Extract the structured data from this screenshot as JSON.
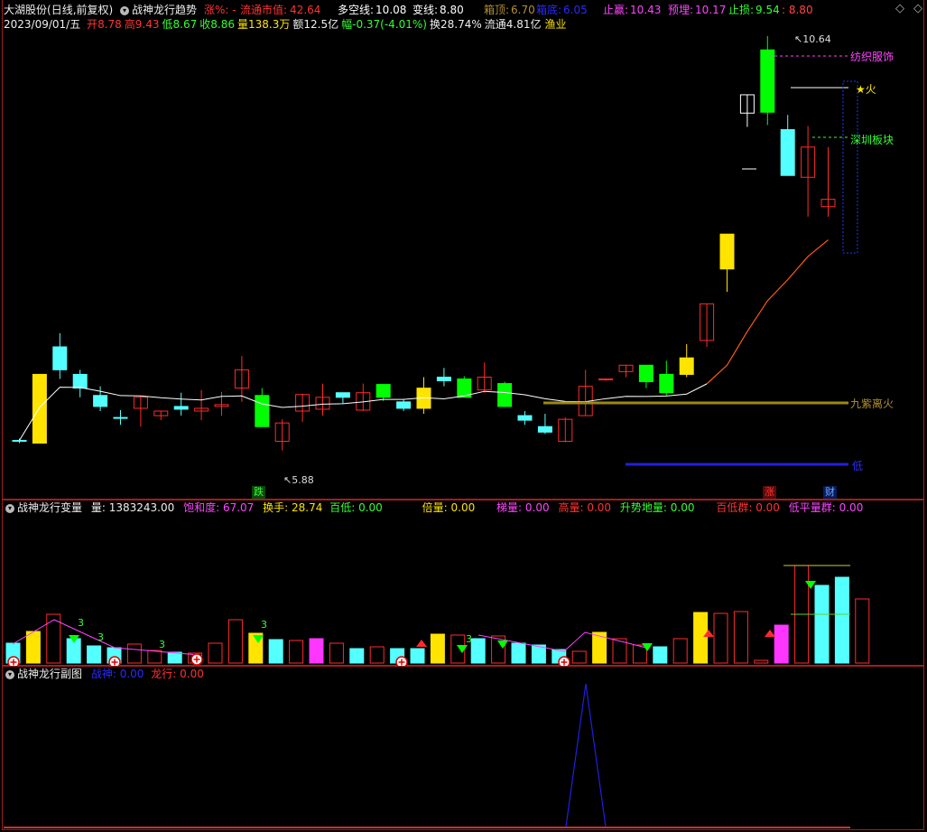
{
  "header1": {
    "stock_name": "大湖股份",
    "period": "(日线,前复权)",
    "indicator_name": "战神龙行趋势",
    "zhang_pct": "涨%: -",
    "liutong_label": "流通市值:",
    "liutong_value": "42.64",
    "duokong_label": "多空线:",
    "duokong_value": "10.08",
    "bianxian_label": "变线:",
    "bianxian_value": "8.80",
    "xiangding_label": "箱顶:",
    "xiangding_value": "6.70",
    "xiangdi_label": "箱底:",
    "xiangdi_value": "6.05",
    "zhiying_label": "止赢:",
    "zhiying_value": "10.43",
    "yuli_label": "预埋:",
    "yuli_value": "10.17",
    "zhisun_label": "止损:",
    "zhisun_value": "9.54",
    "last_value": ": 8.80"
  },
  "header2": {
    "date": "2023/09/01/五",
    "open_label": "开",
    "open": "8.78",
    "high_label": "高",
    "high": "9.43",
    "low_label": "低",
    "low": "8.67",
    "close_label": "收",
    "close": "8.86",
    "vol_label": "量",
    "vol": "138.3万",
    "amount_label": "额",
    "amount": "12.5亿",
    "change_label": "幅",
    "change": "-0.37(-4.01%)",
    "turnover_label": "换",
    "turnover": "28.74%",
    "float_label": "流通",
    "float": "4.81亿",
    "industry": "渔业"
  },
  "main_chart": {
    "high_label": "10.64",
    "low_label": "5.88",
    "tag_textile": "纺织服饰",
    "tag_fire": "★火",
    "tag_shenzhen": "深圳板块",
    "tag_jiuzi": "九紫离火",
    "tag_di": "低",
    "bottom_die": "跌",
    "bottom_zhang": "涨",
    "bottom_cai": "财"
  },
  "panel2": {
    "title": "战神龙行变量",
    "liang_label": "量:",
    "liang_value": "1383243.00",
    "baohe_label": "饱和度:",
    "baohe_value": "67.07",
    "huanshou_label": "换手:",
    "huanshou_value": "28.74",
    "baidi_label": "百低:",
    "baidi_value": "0.00",
    "beiliang_label": "倍量:",
    "beiliang_value": "0.00",
    "tiliang_label": "梯量:",
    "tiliang_value": "0.00",
    "gaoliang_label": "高量:",
    "gaoliang_value": "0.00",
    "shengshi_label": "升势地量:",
    "shengshi_value": "0.00",
    "baidiqun_label": "百低群:",
    "baidiqun_value": "0.00",
    "dipingliang_label": "低平量群:",
    "dipingliang_value": "0.00",
    "mark3": "3"
  },
  "panel3": {
    "title": "战神龙行副图",
    "zhanshen_label": "战神:",
    "zhanshen_value": "0.00",
    "longxing_label": "龙行:",
    "longxing_value": "0.00"
  },
  "colors": {
    "up": "#ff2b2b",
    "down_cyan": "#54ffff",
    "green": "#00ff00",
    "yellow": "#ffe400",
    "magenta": "#ff36ff",
    "blue": "#1a1aff"
  },
  "chart_data": {
    "type": "candlestick",
    "y_range_visible": [
      5.88,
      10.64
    ],
    "candles": [
      {
        "o": 6.22,
        "h": 6.25,
        "l": 6.2,
        "c": 6.23,
        "color": "cyan"
      },
      {
        "o": 6.2,
        "h": 6.95,
        "l": 6.2,
        "c": 6.95,
        "color": "yellow"
      },
      {
        "o": 7.0,
        "h": 7.4,
        "l": 6.9,
        "c": 7.25,
        "color": "cyan"
      },
      {
        "o": 6.95,
        "h": 7.0,
        "l": 6.7,
        "c": 6.8,
        "color": "cyan"
      },
      {
        "o": 6.72,
        "h": 6.82,
        "l": 6.55,
        "c": 6.6,
        "color": "cyan"
      },
      {
        "o": 6.48,
        "h": 6.56,
        "l": 6.4,
        "c": 6.48,
        "color": "cyan"
      },
      {
        "o": 6.58,
        "h": 6.72,
        "l": 6.38,
        "c": 6.7,
        "color": "red"
      },
      {
        "o": 6.5,
        "h": 6.55,
        "l": 6.45,
        "c": 6.55,
        "color": "red"
      },
      {
        "o": 6.6,
        "h": 6.75,
        "l": 6.5,
        "c": 6.57,
        "color": "cyan"
      },
      {
        "o": 6.55,
        "h": 6.78,
        "l": 6.45,
        "c": 6.58,
        "color": "red"
      },
      {
        "o": 6.6,
        "h": 6.76,
        "l": 6.5,
        "c": 6.62,
        "color": "red"
      },
      {
        "o": 6.8,
        "h": 7.15,
        "l": 6.65,
        "c": 7.0,
        "color": "red"
      },
      {
        "o": 6.72,
        "h": 6.8,
        "l": 6.38,
        "c": 6.38,
        "color": "green"
      },
      {
        "o": 6.22,
        "h": 6.46,
        "l": 6.12,
        "c": 6.42,
        "color": "red"
      },
      {
        "o": 6.55,
        "h": 6.74,
        "l": 6.43,
        "c": 6.73,
        "color": "red"
      },
      {
        "o": 6.57,
        "h": 6.85,
        "l": 6.5,
        "c": 6.7,
        "color": "red"
      },
      {
        "o": 6.7,
        "h": 6.75,
        "l": 6.63,
        "c": 6.75,
        "color": "cyan"
      },
      {
        "o": 6.56,
        "h": 6.85,
        "l": 6.55,
        "c": 6.75,
        "color": "red"
      },
      {
        "o": 6.7,
        "h": 6.84,
        "l": 6.66,
        "c": 6.84,
        "color": "green"
      },
      {
        "o": 6.65,
        "h": 6.68,
        "l": 6.55,
        "c": 6.58,
        "color": "cyan"
      },
      {
        "o": 6.58,
        "h": 6.92,
        "l": 6.52,
        "c": 6.8,
        "color": "yellow"
      },
      {
        "o": 6.92,
        "h": 7.02,
        "l": 6.82,
        "c": 6.88,
        "color": "cyan"
      },
      {
        "o": 6.9,
        "h": 6.93,
        "l": 6.7,
        "c": 6.7,
        "color": "green"
      },
      {
        "o": 6.78,
        "h": 7.08,
        "l": 6.75,
        "c": 6.92,
        "color": "red"
      },
      {
        "o": 6.85,
        "h": 6.87,
        "l": 6.6,
        "c": 6.6,
        "color": "green"
      },
      {
        "o": 6.5,
        "h": 6.55,
        "l": 6.4,
        "c": 6.45,
        "color": "cyan"
      },
      {
        "o": 6.38,
        "h": 6.52,
        "l": 6.3,
        "c": 6.32,
        "color": "cyan"
      },
      {
        "o": 6.22,
        "h": 6.48,
        "l": 6.21,
        "c": 6.46,
        "color": "red"
      },
      {
        "o": 6.5,
        "h": 7.0,
        "l": 6.5,
        "c": 6.82,
        "color": "red"
      },
      {
        "o": 6.9,
        "h": 6.9,
        "l": 6.88,
        "c": 6.9,
        "color": "red"
      },
      {
        "o": 6.98,
        "h": 7.05,
        "l": 6.92,
        "c": 7.05,
        "color": "red"
      },
      {
        "o": 7.05,
        "h": 7.05,
        "l": 6.8,
        "c": 6.87,
        "color": "green"
      },
      {
        "o": 6.95,
        "h": 7.1,
        "l": 6.72,
        "c": 6.75,
        "color": "green"
      },
      {
        "o": 6.95,
        "h": 7.28,
        "l": 6.92,
        "c": 7.13,
        "color": "yellow"
      },
      {
        "o": 7.32,
        "h": 7.72,
        "l": 7.25,
        "c": 7.72,
        "color": "red"
      },
      {
        "o": 8.1,
        "h": 8.48,
        "l": 7.85,
        "c": 8.48,
        "color": "yellow"
      },
      {
        "o": 9.8,
        "h": 10.0,
        "l": 9.65,
        "c": 10.0,
        "color": "white"
      },
      {
        "o": 10.49,
        "h": 10.64,
        "l": 9.67,
        "c": 9.81,
        "color": "green"
      },
      {
        "o": 9.62,
        "h": 9.78,
        "l": 9.12,
        "c": 9.12,
        "color": "cyan"
      },
      {
        "o": 9.1,
        "h": 9.66,
        "l": 8.67,
        "c": 9.43,
        "color": "red"
      },
      {
        "o": 8.78,
        "h": 9.43,
        "l": 8.67,
        "c": 8.86,
        "color": "red"
      }
    ],
    "volume_bars": [
      "cyan",
      "yellow",
      "red",
      "cyan",
      "cyan",
      "cyan",
      "red",
      "red",
      "cyan",
      "red",
      "red",
      "red",
      "yellow",
      "cyan",
      "red",
      "magenta",
      "red",
      "cyan",
      "red",
      "cyan",
      "cyan",
      "yellow",
      "red",
      "cyan",
      "red",
      "cyan",
      "cyan",
      "cyan",
      "red",
      "yellow",
      "red",
      "red",
      "cyan",
      "red",
      "yellow",
      "red",
      "red",
      "red",
      "magenta",
      "red",
      "cyan",
      "cyan",
      "red",
      "red"
    ],
    "volume_values": [
      22,
      35,
      54,
      27,
      19,
      17,
      21,
      14,
      12,
      11,
      22,
      48,
      33,
      26,
      25,
      27,
      22,
      16,
      18,
      16,
      16,
      32,
      31,
      27,
      30,
      22,
      20,
      15,
      13,
      34,
      27,
      20,
      18,
      27,
      56,
      55,
      57,
      3,
      42,
      108,
      86,
      95,
      71
    ],
    "sub_chart_spike": {
      "peak": 1.0
    }
  }
}
